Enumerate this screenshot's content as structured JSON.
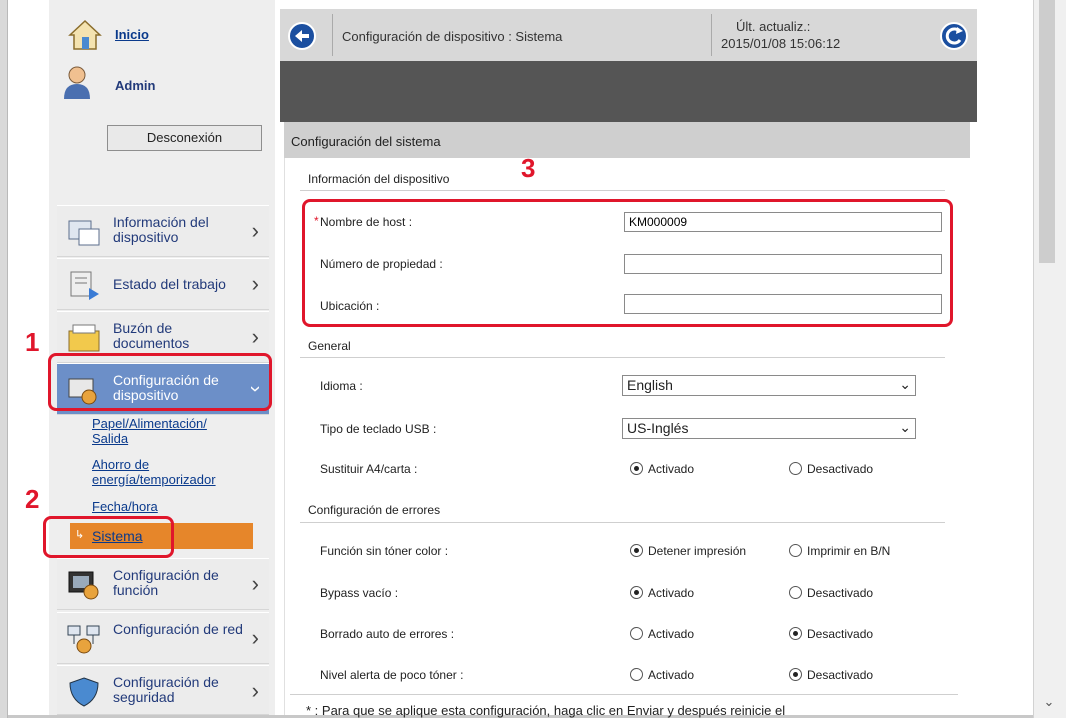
{
  "header": {
    "home_label": "Inicio",
    "user_label": "Admin",
    "logout_label": "Desconexión",
    "page_title": "Configuración de dispositivo : Sistema",
    "last_update_label": "Últ. actualiz.:",
    "last_update_value": "2015/01/08 15:06:12"
  },
  "sidebar": {
    "items": [
      {
        "label": "Información del dispositivo"
      },
      {
        "label": "Estado del trabajo"
      },
      {
        "label": "Buzón de documentos"
      },
      {
        "label": "Configuración de dispositivo"
      },
      {
        "label": "Configuración de función"
      },
      {
        "label": "Configuración de red"
      },
      {
        "label": "Configuración de seguridad"
      }
    ],
    "submenu": [
      {
        "label": "Papel/Alimentación/"
      },
      {
        "label": "Salida"
      },
      {
        "label": "Ahorro de"
      },
      {
        "label": "energía/temporizador"
      },
      {
        "label": "Fecha/hora"
      },
      {
        "label": "Sistema"
      }
    ]
  },
  "panel": {
    "title": "Configuración del sistema",
    "device_info_section": "Información del dispositivo",
    "required_mark": "*",
    "host_name_label": "Nombre de host :",
    "host_name_value": "KM000009",
    "asset_number_label": "Número de propiedad :",
    "asset_number_value": "",
    "location_label": "Ubicación :",
    "location_value": "",
    "general_section": "General",
    "language_label": "Idioma :",
    "language_value": "English",
    "usb_keyboard_label": "Tipo de teclado USB :",
    "usb_keyboard_value": "US-Inglés",
    "a4_letter_label": "Sustituir A4/carta :",
    "errors_section": "Configuración de errores",
    "no_color_toner_label": "Función sin tóner color :",
    "stop_print_option": "Detener impresión",
    "print_bw_option": "Imprimir en B/N",
    "bypass_empty_label": "Bypass vacío :",
    "auto_error_clear_label": "Borrado auto de errores :",
    "low_toner_label": "Nivel alerta de poco tóner :",
    "on_option": "Activado",
    "off_option": "Desactivado",
    "footnote": "* :  Para que se aplique esta configuración, haga clic en Enviar y después reinicie el"
  },
  "callouts": {
    "one": "1",
    "two": "2",
    "three": "3"
  },
  "colors": {
    "accent_blue": "#6c8fc8",
    "selected_orange": "#e6862a",
    "callout_red": "#e0162b"
  }
}
